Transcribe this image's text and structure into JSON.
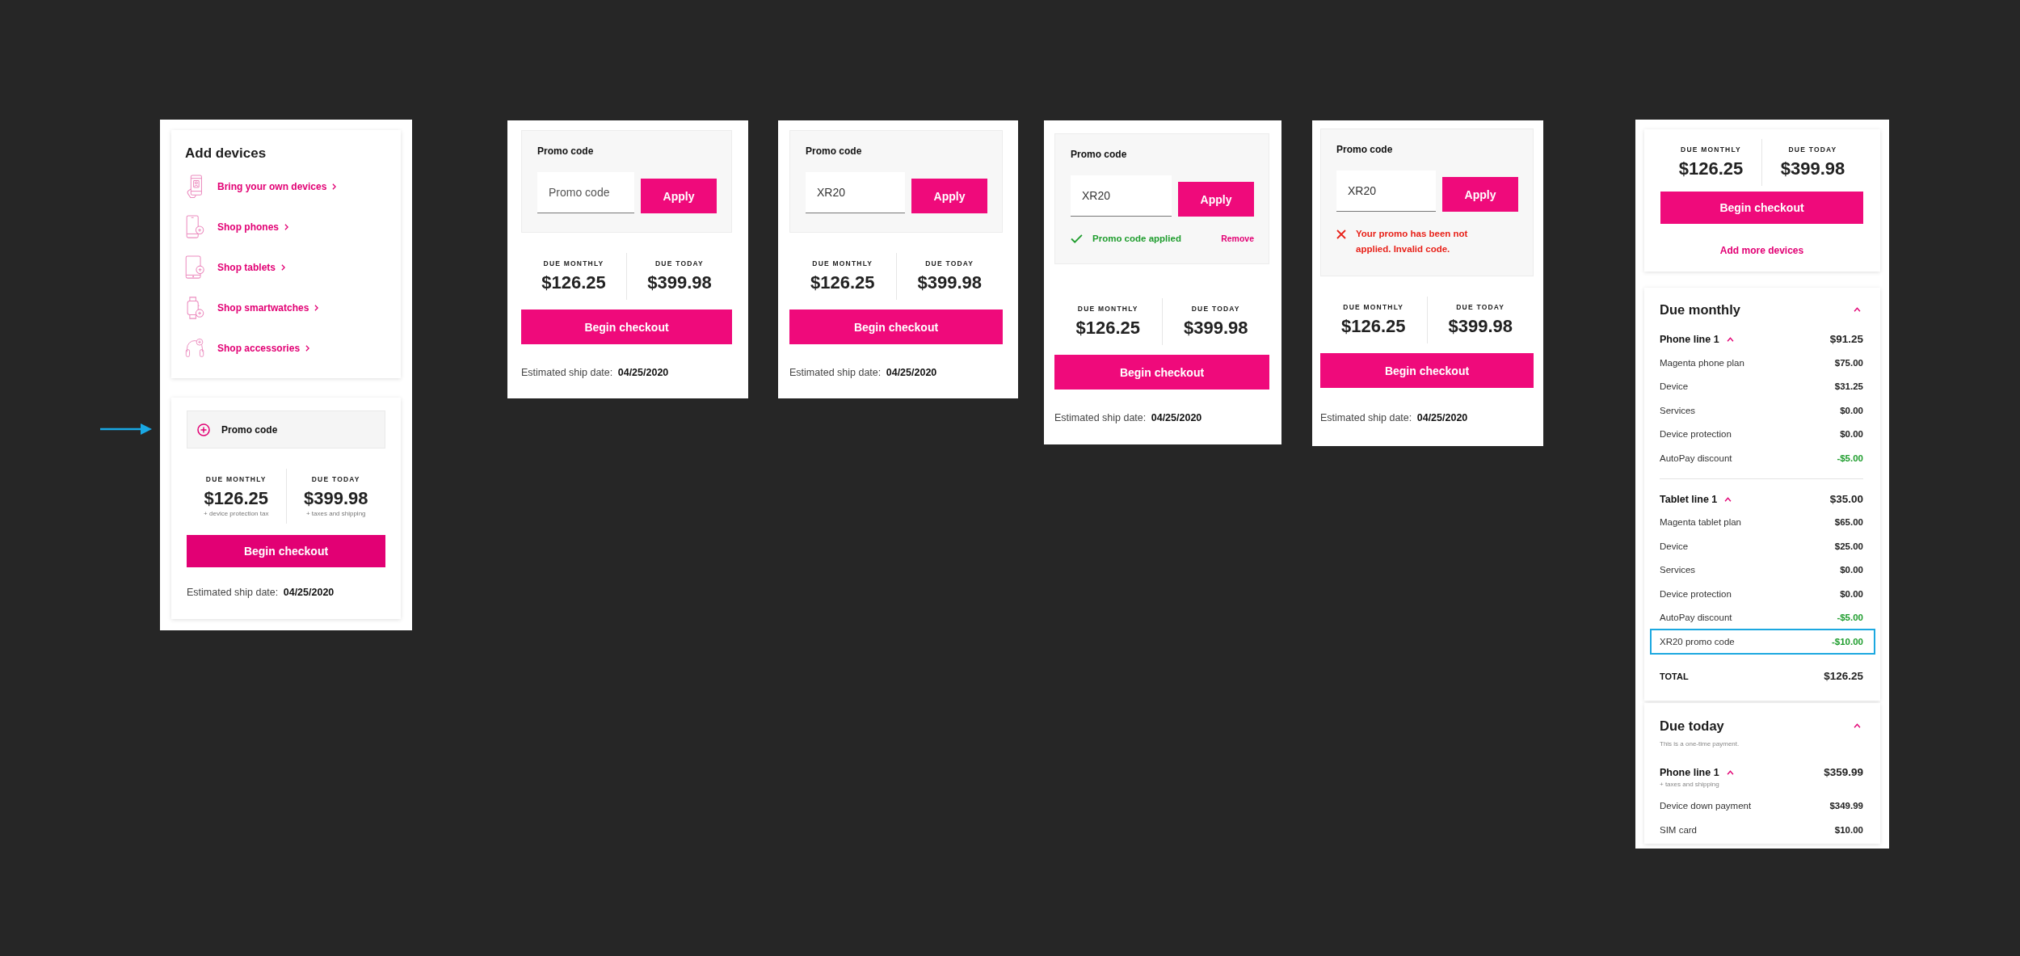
{
  "screens": [
    {
      "kind": "cart",
      "add_devices": {
        "title": "Add devices",
        "links": [
          "Bring your own devices",
          "Shop phones",
          "Shop tablets",
          "Shop smartwatches",
          "Shop accessories"
        ]
      },
      "promo": {
        "expanded": false,
        "title": "Promo code"
      },
      "totals": [
        {
          "label": "DUE MONTHLY",
          "amount": "$126.25",
          "note": "+ device protection tax"
        },
        {
          "label": "DUE TODAY",
          "amount": "$399.98",
          "note": "+ taxes and shipping"
        }
      ],
      "checkout_button": "Begin checkout",
      "ship_date": {
        "label": "Estimated ship date:",
        "value": "04/25/2020"
      }
    },
    {
      "kind": "promo",
      "promo": {
        "expanded": true,
        "title": "Promo code",
        "field": {
          "placeholder": "Promo code"
        },
        "apply_button": "Apply"
      },
      "totals": [
        {
          "label": "DUE MONTHLY",
          "amount": "$126.25"
        },
        {
          "label": "DUE TODAY",
          "amount": "$399.98"
        }
      ],
      "checkout_button": "Begin checkout",
      "ship_date": {
        "label": "Estimated ship date:",
        "value": "04/25/2020"
      }
    },
    {
      "kind": "promo",
      "promo": {
        "expanded": true,
        "title": "Promo code",
        "field": {
          "value": "XR20"
        },
        "apply_button": "Apply"
      },
      "totals": [
        {
          "label": "DUE MONTHLY",
          "amount": "$126.25"
        },
        {
          "label": "DUE TODAY",
          "amount": "$399.98"
        }
      ],
      "checkout_button": "Begin checkout",
      "ship_date": {
        "label": "Estimated ship date:",
        "value": "04/25/2020"
      }
    },
    {
      "kind": "promo",
      "promo": {
        "expanded": true,
        "title": "Promo code",
        "field": {
          "value": "XR20"
        },
        "apply_button": "Apply",
        "message": {
          "kind": "success",
          "text": "Promo code applied",
          "action": "Remove"
        }
      },
      "totals": [
        {
          "label": "DUE MONTHLY",
          "amount": "$126.25"
        },
        {
          "label": "DUE TODAY",
          "amount": "$399.98"
        }
      ],
      "checkout_button": "Begin checkout",
      "ship_date": {
        "label": "Estimated ship date:",
        "value": "04/25/2020"
      }
    },
    {
      "kind": "promo",
      "promo": {
        "expanded": true,
        "title": "Promo code",
        "field": {
          "value": "XR20"
        },
        "apply_button": "Apply",
        "message": {
          "kind": "error",
          "text": "Your promo has been not applied. Invalid code."
        }
      },
      "totals": [
        {
          "label": "DUE MONTHLY",
          "amount": "$126.25"
        },
        {
          "label": "DUE TODAY",
          "amount": "$399.98"
        }
      ],
      "checkout_button": "Begin checkout",
      "ship_date": {
        "label": "Estimated ship date:",
        "value": "04/25/2020"
      }
    },
    {
      "kind": "summary",
      "totals": [
        {
          "label": "DUE MONTHLY",
          "amount": "$126.25"
        },
        {
          "label": "DUE TODAY",
          "amount": "$399.98"
        }
      ],
      "checkout_button": "Begin checkout",
      "add_more_link": "Add more devices",
      "breakdowns": [
        {
          "title": "Due monthly",
          "expanded": true,
          "groups": [
            {
              "name": "Phone line 1",
              "expanded": true,
              "amount": "$91.25",
              "items": [
                {
                  "label": "Magenta phone plan",
                  "amount": "$75.00",
                  "discount": false,
                  "highlighted": false
                },
                {
                  "label": "Device",
                  "amount": "$31.25",
                  "discount": false,
                  "highlighted": false
                },
                {
                  "label": "Services",
                  "amount": "$0.00",
                  "discount": false,
                  "highlighted": false
                },
                {
                  "label": "Device protection",
                  "amount": "$0.00",
                  "discount": false,
                  "highlighted": false
                },
                {
                  "label": "AutoPay discount",
                  "amount": "-$5.00",
                  "discount": true,
                  "highlighted": false
                }
              ]
            },
            {
              "name": "Tablet line 1",
              "expanded": true,
              "amount": "$35.00",
              "items": [
                {
                  "label": "Magenta tablet plan",
                  "amount": "$65.00",
                  "discount": false,
                  "highlighted": false
                },
                {
                  "label": "Device",
                  "amount": "$25.00",
                  "discount": false,
                  "highlighted": false
                },
                {
                  "label": "Services",
                  "amount": "$0.00",
                  "discount": false,
                  "highlighted": false
                },
                {
                  "label": "Device protection",
                  "amount": "$0.00",
                  "discount": false,
                  "highlighted": false
                },
                {
                  "label": "AutoPay discount",
                  "amount": "-$5.00",
                  "discount": true,
                  "highlighted": false
                },
                {
                  "label": "XR20 promo code",
                  "amount": "-$10.00",
                  "discount": true,
                  "highlighted": true
                }
              ]
            }
          ],
          "total": {
            "label": "TOTAL",
            "amount": "$126.25"
          }
        },
        {
          "title": "Due today",
          "expanded": true,
          "subtitle": "This is a one-time payment.",
          "groups": [
            {
              "name": "Phone line 1",
              "expanded": true,
              "note": "+ taxes and shipping",
              "amount": "$359.99",
              "items": [
                {
                  "label": "Device down payment",
                  "amount": "$349.99",
                  "discount": false,
                  "highlighted": false
                },
                {
                  "label": "SIM card",
                  "amount": "$10.00",
                  "discount": false,
                  "highlighted": false
                }
              ]
            }
          ]
        }
      ]
    }
  ]
}
